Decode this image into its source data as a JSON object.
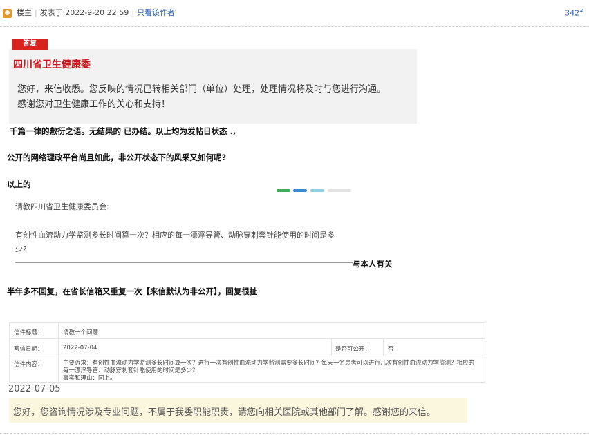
{
  "post": {
    "author_label": "楼主",
    "posted_at": "发表于 2022-9-20 22:59",
    "only_author_link": "只看该作者",
    "floor_number": "342",
    "floor_suffix": "#"
  },
  "reply_image": {
    "badge": "答复",
    "organization": "四川省卫生健康委",
    "line1": "您好，来信收悉。您反映的情况已转相关部门（单位）处理，处理情况将及时与您进行沟通。",
    "line2": "感谢您对卫生健康工作的关心和支持！"
  },
  "comments": {
    "c1": "千篇一律的敷衍之语。无结果的  已办结。以上均为发帖日状态 .,",
    "c2": "公开的网络理政平台尚且如此，非公开状态下的风采又如何呢?",
    "c3": "以上的",
    "c4": "与本人有关",
    "c5": "半年多不回复，在省长信箱又重复一次【来信默认为非公开】，回复很扯"
  },
  "quote_image": {
    "salutation": "请教四川省卫生健康委员会:",
    "question_line1": "有创性血流动力学监测多长时间算一次？相应的每一漂浮导管、动脉穿刺套针能使用的时间是多",
    "question_line2": "少?"
  },
  "form_image": {
    "title_label": "信件标题：",
    "title_value": "请教一个问题",
    "date_label": "写信日期：",
    "date_value": "2022-07-04",
    "public_label": "是否可公开：",
    "public_value": "否",
    "content_label": "信件内容：",
    "content_line1": "主要诉求：有创性血流动力学监测多长时间算一次？进行一次有创性血流动力学监测需要多长时间？每天一名患者可以进行几次有创性血流动力学监测？相应的",
    "content_line2": "每一漂浮导管、动脉穿刺套针能使用的时间是多少？",
    "content_line3": "事实和理由：同上。"
  },
  "response": {
    "date": "2022-07-05",
    "text": "您好，您咨询情况涉及专业问题，不属于我委职能职责，请您向相关医院或其他部门了解。感谢您的来信。"
  },
  "colors": {
    "link": "#2a5fb0",
    "badge_red": "#d9211e",
    "org_red": "#c8161d",
    "banner_bg": "#fbf6de"
  }
}
